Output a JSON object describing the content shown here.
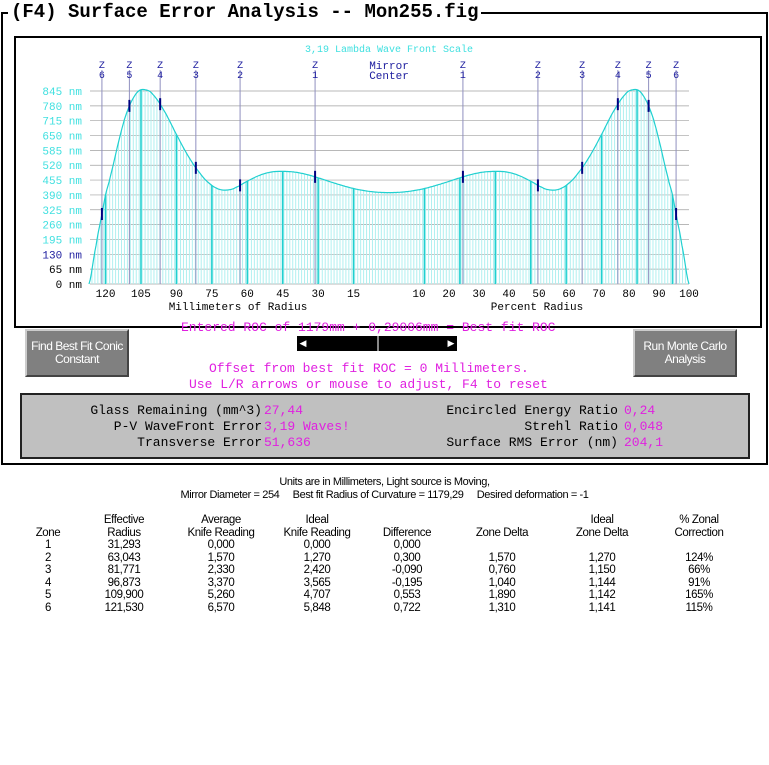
{
  "title": "(F4)  Surface Error Analysis -- Mon255.fig",
  "chart_data": {
    "type": "area",
    "title": "3,19 Lambda Wave Front Scale",
    "xlabel_left": "Millimeters of Radius",
    "xlabel_right": "Percent Radius",
    "center_label": [
      "Mirror",
      "Center"
    ],
    "ylim": [
      0,
      845
    ],
    "y_ticks": [
      0,
      65,
      130,
      195,
      260,
      325,
      390,
      455,
      520,
      585,
      650,
      715,
      780,
      845
    ],
    "y_unit": "nm",
    "mirror_radius_mm": 127,
    "x_ticks_mm": [
      120,
      105,
      90,
      75,
      60,
      45,
      30,
      15
    ],
    "x_ticks_percent": [
      10,
      20,
      30,
      40,
      50,
      60,
      70,
      80,
      90,
      100
    ],
    "zones": [
      {
        "label": "Z",
        "num": "1",
        "radius_mm": 31.293
      },
      {
        "label": "Z",
        "num": "2",
        "radius_mm": 63.043
      },
      {
        "label": "Z",
        "num": "3",
        "radius_mm": 81.771
      },
      {
        "label": "Z",
        "num": "4",
        "radius_mm": 96.873
      },
      {
        "label": "Z",
        "num": "5",
        "radius_mm": 109.9
      },
      {
        "label": "Z",
        "num": "6",
        "radius_mm": 121.53
      }
    ],
    "profile_mm": [
      0,
      5,
      10,
      15,
      20,
      25,
      30,
      35,
      40,
      45,
      50,
      55,
      60,
      65,
      68,
      72,
      76,
      80,
      85,
      90,
      95,
      100,
      103,
      106,
      109,
      112,
      115,
      118,
      120,
      122,
      124,
      127
    ],
    "profile_nm": [
      400,
      402,
      408,
      418,
      432,
      448,
      465,
      480,
      490,
      493,
      490,
      475,
      450,
      422,
      412,
      415,
      440,
      485,
      560,
      655,
      755,
      830,
      850,
      845,
      800,
      720,
      600,
      470,
      390,
      280,
      170,
      0
    ],
    "colors": {
      "fill": "#b0f0f0",
      "line": "#20d0d0",
      "grid": "#a0a0a0",
      "zone": "#9090c0",
      "label": "#40e0e0",
      "zone_label": "#2020a0"
    }
  },
  "controls": {
    "conic_button": "Find Best Fit Conic Constant",
    "monte_button": "Run Monte Carlo Analysis",
    "roc_text": "Entered ROC of 1179mm + 0,29006mm = Best fit ROC",
    "offset_text": "Offset from best fit ROC = 0 Millimeters.",
    "help_text": "Use L/R arrows or mouse to adjust, F4 to reset"
  },
  "stats": {
    "glass_label": "Glass Remaining (mm^3)",
    "glass": "27,44",
    "pv_label": "P-V WaveFront Error",
    "pv": "3,19 Waves!",
    "trans_label": "Transverse Error",
    "trans": "51,636",
    "ee_label": "Encircled Energy Ratio",
    "ee": "0,24",
    "strehl_label": "Strehl Ratio",
    "strehl": "0,048",
    "rms_label": "Surface RMS Error (nm)",
    "rms": "204,1"
  },
  "info": {
    "line1": "Units are in Millimeters, Light source is Moving,",
    "line2": "Mirror Diameter = 254     Best fit Radius of Curvature = 1179,29     Desired deformation = -1"
  },
  "table": {
    "headers": [
      [
        "",
        "Zone"
      ],
      [
        "Effective",
        "Radius"
      ],
      [
        "Average",
        "Knife Reading"
      ],
      [
        "Ideal",
        "Knife Reading"
      ],
      [
        "",
        "Difference"
      ],
      [
        "",
        "Zone Delta"
      ],
      [
        "Ideal",
        "Zone Delta"
      ],
      [
        "% Zonal",
        "Correction"
      ]
    ],
    "rows": [
      [
        "1",
        "31,293",
        "0,000",
        "0,000",
        "0,000",
        "",
        "",
        ""
      ],
      [
        "2",
        "63,043",
        "1,570",
        "1,270",
        "0,300",
        "1,570",
        "1,270",
        "124%"
      ],
      [
        "3",
        "81,771",
        "2,330",
        "2,420",
        "-0,090",
        "0,760",
        "1,150",
        "66%"
      ],
      [
        "4",
        "96,873",
        "3,370",
        "3,565",
        "-0,195",
        "1,040",
        "1,144",
        "91%"
      ],
      [
        "5",
        "109,900",
        "5,260",
        "4,707",
        "0,553",
        "1,890",
        "1,142",
        "165%"
      ],
      [
        "6",
        "121,530",
        "6,570",
        "5,848",
        "0,722",
        "1,310",
        "1,141",
        "115%"
      ]
    ]
  }
}
